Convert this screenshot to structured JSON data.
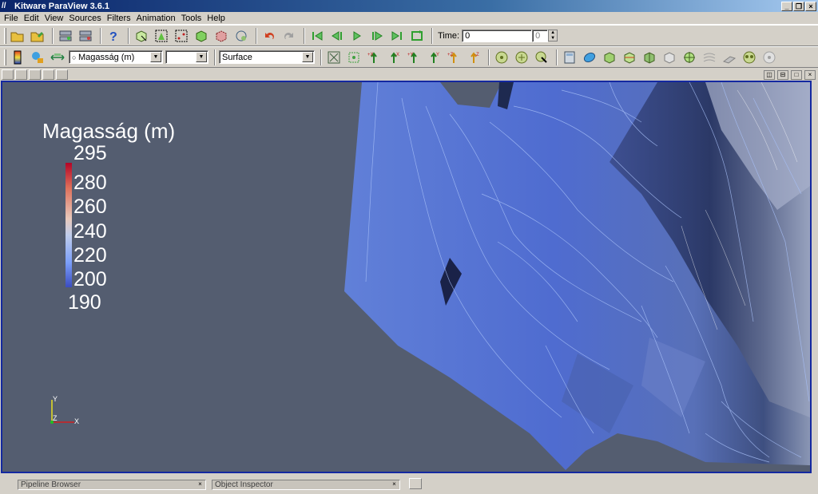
{
  "window": {
    "title": "Kitware ParaView 3.6.1"
  },
  "menu": {
    "items": [
      "File",
      "Edit",
      "View",
      "Sources",
      "Filters",
      "Animation",
      "Tools",
      "Help"
    ]
  },
  "toolbar1": {
    "time_label": "Time:",
    "time_value": "0",
    "time_index": "0"
  },
  "toolbar2": {
    "color_by_value": "Magasság (m)",
    "component_value": "",
    "representation_value": "Surface"
  },
  "legend": {
    "title": "Magasság (m)",
    "ticks": [
      "295",
      "280",
      "260",
      "240",
      "220",
      "200",
      "190"
    ]
  },
  "axes": {
    "y": "Y",
    "z": "Z",
    "x": "X"
  },
  "dock": {
    "pipeline_browser": "Pipeline Browser",
    "object_inspector": "Object Inspector"
  },
  "colors": {
    "background": "#545d70",
    "surface": "#5a78d0",
    "frame": "#1428a0"
  }
}
